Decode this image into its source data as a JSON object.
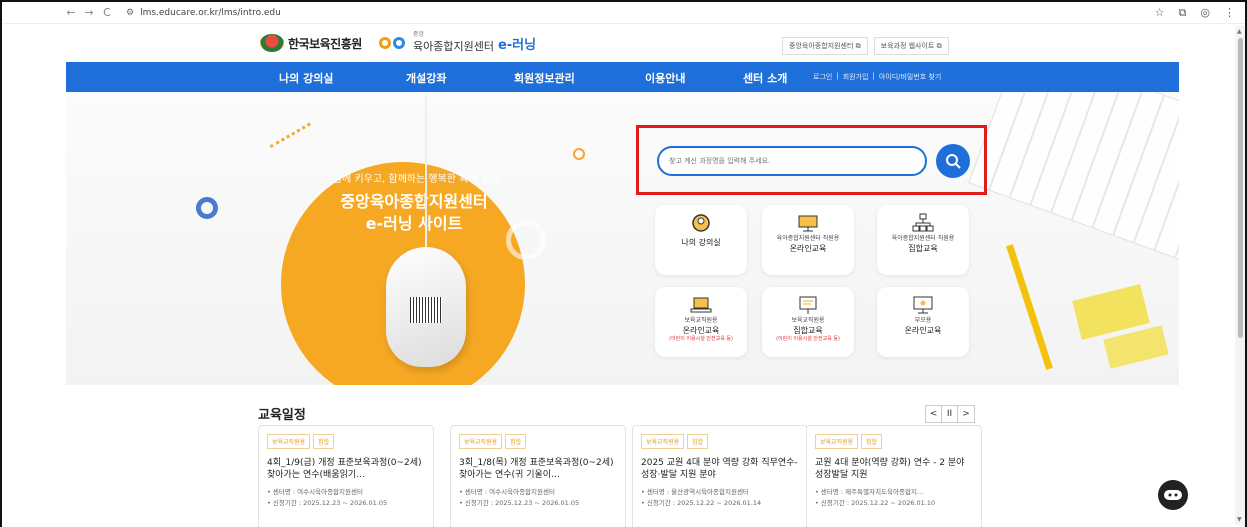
{
  "browser": {
    "url": "lms.educare.or.kr/lms/intro.edu",
    "back": "←",
    "forward": "→",
    "reload": "C",
    "right_icons": [
      "☆",
      "⧉",
      "◎",
      "⋮"
    ]
  },
  "header": {
    "org_name": "한국보육진흥원",
    "center_sub": "중앙",
    "center_name": "육아종합지원센터",
    "elearning": "e-러닝",
    "top_links": [
      "중앙육아종합지원센터 ⧉",
      "보육과정 웹사이트 ⧉"
    ]
  },
  "gnb": {
    "menus": [
      "나의 강의실",
      "개설강좌",
      "회원정보관리",
      "이용안내",
      "센터 소개"
    ],
    "util": [
      "로그인",
      "|",
      "회원가입",
      "|",
      "아이디/비밀번호 찾기"
    ]
  },
  "hero": {
    "line1": "함께 키우고, 함께하는 행복한 육아 실현",
    "line2": "중앙육아종합지원센터",
    "line3": "e-러닝 사이트"
  },
  "search": {
    "placeholder": "찾고 계신 과정명을 입력해 주세요."
  },
  "menu_cards": [
    {
      "small": "",
      "big": "나의 강의실",
      "red": "",
      "icon": "user-circle-icon"
    },
    {
      "small": "육아종합지원센터 직원용",
      "big": "온라인교육",
      "red": "",
      "icon": "monitor-icon"
    },
    {
      "small": "육아종합지원센터 직원용",
      "big": "집합교육",
      "red": "",
      "icon": "org-chart-icon"
    },
    {
      "small": "보육교직원용",
      "big": "온라인교육",
      "red": "(어린이 이용시설 안전교육 등)",
      "icon": "laptop-icon"
    },
    {
      "small": "보육교직원용",
      "big": "집합교육",
      "red": "(어린이 이용시설 안전교육 등)",
      "icon": "presentation-icon"
    },
    {
      "small": "부모용",
      "big": "온라인교육",
      "red": "",
      "icon": "desktop-icon"
    }
  ],
  "schedule": {
    "title": "교육일정",
    "pager": [
      "<",
      "II",
      ">"
    ],
    "cards": [
      {
        "tags": [
          "보육교직원용",
          "집합"
        ],
        "title": "4회_1/9(금) 개정 표준보육과정(0~2세) 찾아가는 연수(배움읽기…",
        "center": "• 센터명 : 여수시육아종합지원센터",
        "period": "• 신청기간 : 2025.12.23 ~ 2026.01.05"
      },
      {
        "tags": [
          "보육교직원용",
          "집합"
        ],
        "title": "3회_1/8(목) 개정 표준보육과정(0~2세) 찾아가는 연수(귀 기울이…",
        "center": "• 센터명 : 여수시육아종합지원센터",
        "period": "• 신청기간 : 2025.12.23 ~ 2026.01.05"
      },
      {
        "tags": [
          "보육교직원용",
          "집합"
        ],
        "title": "2025 교원 4대 분야 역량 강화 직무연수- 성장·발달 지원 분야",
        "center": "• 센터명 : 울산광역시육아종합지원센터",
        "period": "• 신청기간 : 2025.12.22 ~ 2026.01.14"
      },
      {
        "tags": [
          "보육교직원용",
          "집합"
        ],
        "title": "교원 4대 분야(역량 강화) 연수 - 2 분야 성장발달 지원",
        "center": "• 센터명 : 제주특별자치도육아종합지…",
        "period": "• 신청기간 : 2025.12.22 ~ 2026.01.10"
      }
    ]
  },
  "colors": {
    "primary": "#1e6fd9",
    "hero_orange": "#f7a823",
    "highlight": "#e01b1b"
  }
}
